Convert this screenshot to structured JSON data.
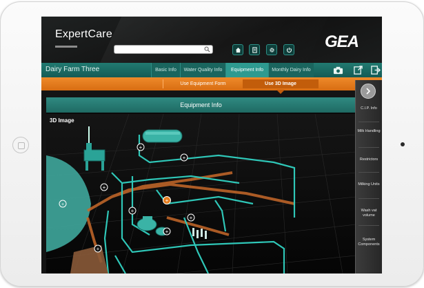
{
  "header": {
    "app_title": "ExpertCare",
    "search_placeholder": "",
    "brand_logo": "GEA",
    "buttons": [
      {
        "name": "home-icon"
      },
      {
        "name": "document-icon"
      },
      {
        "name": "gear-icon"
      },
      {
        "name": "power-icon"
      }
    ]
  },
  "nav": {
    "farm_name": "Dairy Farm Three",
    "tabs": [
      {
        "label": "Basic Info",
        "active": false
      },
      {
        "label": "Water Quality Info",
        "active": false
      },
      {
        "label": "Equipment Info",
        "active": true
      },
      {
        "label": "Monthly Dairy Info",
        "active": false
      }
    ],
    "icons": [
      "camera-icon",
      "export-icon",
      "logout-icon"
    ]
  },
  "subnav": {
    "items": [
      {
        "label": "Use Equipment Form",
        "active": false
      },
      {
        "label": "Use 3D Image",
        "active": true
      }
    ]
  },
  "panel": {
    "title": "Equipment Info",
    "section_label": "3D Image"
  },
  "right_menu": {
    "items": [
      {
        "label": "C.I.P. Info"
      },
      {
        "label": "Milk Handling"
      },
      {
        "label": "Restrictors"
      },
      {
        "label": "Milking Units"
      },
      {
        "label": "Wash vat volume"
      },
      {
        "label": "System Components"
      }
    ]
  },
  "colors": {
    "accent_teal": "#2e9a90",
    "accent_orange": "#e47b1c",
    "pipe_cyan": "#2fc7b8",
    "pipe_orange": "#c7692a"
  }
}
